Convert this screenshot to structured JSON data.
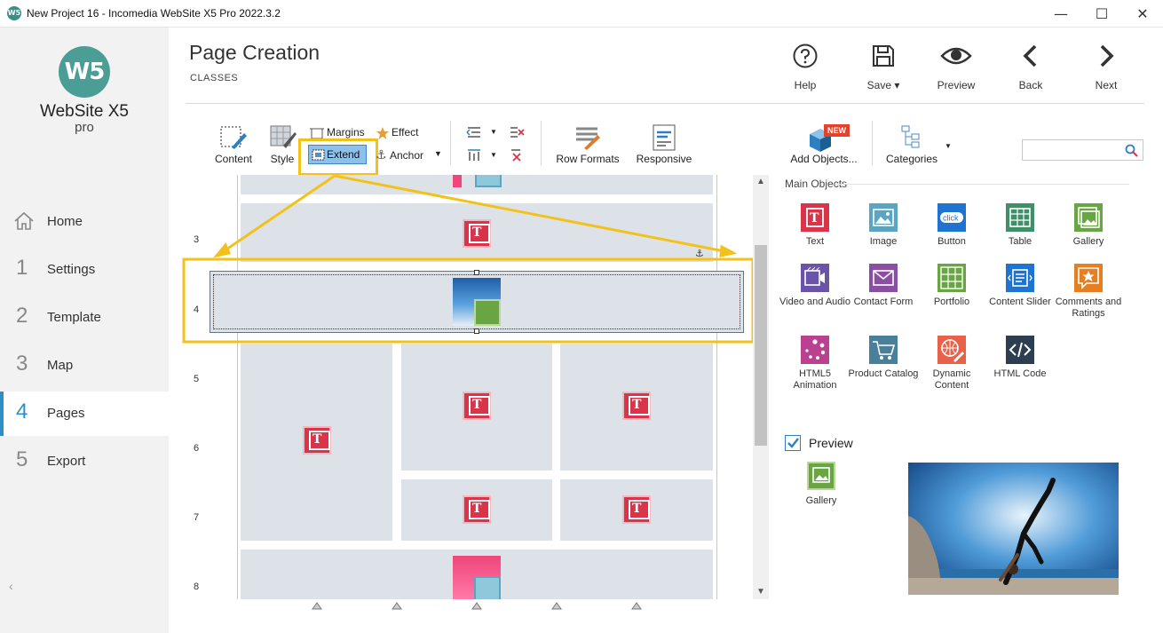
{
  "window": {
    "title": "New Project 16 - Incomedia WebSite X5 Pro 2022.3.2",
    "app_icon": "W5",
    "minimize_glyph": "—",
    "maximize_glyph": "☐",
    "close_glyph": "✕"
  },
  "sidebar": {
    "logo_mark": "W5",
    "logo_name": "WebSite X5",
    "logo_sub": "pro",
    "items": [
      {
        "num": "",
        "label": "Home",
        "icon": "home-icon"
      },
      {
        "num": "1",
        "label": "Settings"
      },
      {
        "num": "2",
        "label": "Template"
      },
      {
        "num": "3",
        "label": "Map"
      },
      {
        "num": "4",
        "label": "Pages",
        "active": true
      },
      {
        "num": "5",
        "label": "Export"
      }
    ],
    "collapse_glyph": "‹"
  },
  "header": {
    "title": "Page Creation",
    "subtitle": "CLASSES",
    "buttons": [
      {
        "label": "Help",
        "icon": "help-icon"
      },
      {
        "label": "Save ▾",
        "icon": "save-icon"
      },
      {
        "label": "Preview",
        "icon": "eye-icon"
      },
      {
        "label": "Back",
        "icon": "chevron-left-icon"
      },
      {
        "label": "Next",
        "icon": "chevron-right-icon"
      }
    ]
  },
  "toolbar": {
    "content": "Content",
    "style": "Style",
    "margins": "Margins",
    "effect": "Effect",
    "extend": "Extend",
    "anchor": "Anchor",
    "row_formats": "Row Formats",
    "responsive": "Responsive",
    "add_objects": "Add Objects...",
    "new_badge": "NEW",
    "categories": "Categories",
    "search_placeholder": ""
  },
  "canvas": {
    "rows": [
      "3",
      "4",
      "5",
      "6",
      "7",
      "8"
    ]
  },
  "objects": {
    "section_title": "Main Objects",
    "items": [
      {
        "label": "Text",
        "icon": "text-object-icon",
        "color": "#d9344a"
      },
      {
        "label": "Image",
        "icon": "image-object-icon",
        "color": "#5aa6c2"
      },
      {
        "label": "Button",
        "icon": "button-object-icon",
        "color": "#1f74d1",
        "badge": "click"
      },
      {
        "label": "Table",
        "icon": "table-object-icon",
        "color": "#3f8f68"
      },
      {
        "label": "Gallery",
        "icon": "gallery-object-icon",
        "color": "#6aa544"
      },
      {
        "label": "Video and Audio",
        "icon": "video-object-icon",
        "color": "#6a54a8"
      },
      {
        "label": "Contact Form",
        "icon": "contact-form-icon",
        "color": "#8a4fa3"
      },
      {
        "label": "Portfolio",
        "icon": "portfolio-object-icon",
        "color": "#6aa544"
      },
      {
        "label": "Content Slider",
        "icon": "content-slider-icon",
        "color": "#1f74d1"
      },
      {
        "label": "Comments and Ratings",
        "icon": "comments-ratings-icon",
        "color": "#e67e22"
      },
      {
        "label": "HTML5 Animation",
        "icon": "html5-animation-icon",
        "color": "#b9418f"
      },
      {
        "label": "Product Catalog",
        "icon": "product-catalog-icon",
        "color": "#4a7f99"
      },
      {
        "label": "Dynamic Content",
        "icon": "dynamic-content-icon",
        "color": "#e8624a"
      },
      {
        "label": "HTML Code",
        "icon": "html-code-icon",
        "color": "#2c3e50"
      }
    ]
  },
  "preview": {
    "label": "Preview",
    "checked": true,
    "selected_object": "Gallery"
  },
  "colors": {
    "accent": "#2e8fc6",
    "highlight": "#f2c21b",
    "cell": "#dde2e8"
  }
}
